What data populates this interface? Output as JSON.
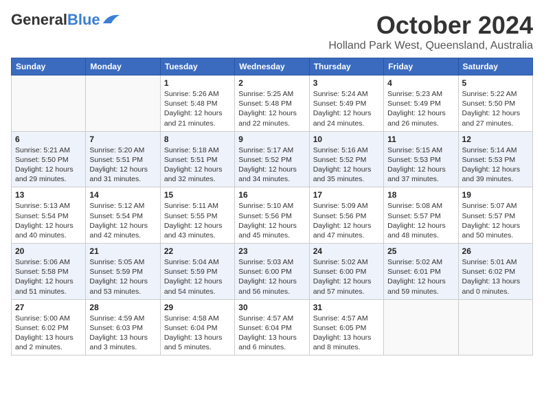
{
  "header": {
    "logo_general": "General",
    "logo_blue": "Blue",
    "month": "October 2024",
    "location": "Holland Park West, Queensland, Australia"
  },
  "days_of_week": [
    "Sunday",
    "Monday",
    "Tuesday",
    "Wednesday",
    "Thursday",
    "Friday",
    "Saturday"
  ],
  "weeks": [
    [
      {
        "day": "",
        "sunrise": "",
        "sunset": "",
        "daylight": ""
      },
      {
        "day": "",
        "sunrise": "",
        "sunset": "",
        "daylight": ""
      },
      {
        "day": "1",
        "sunrise": "Sunrise: 5:26 AM",
        "sunset": "Sunset: 5:48 PM",
        "daylight": "Daylight: 12 hours and 21 minutes."
      },
      {
        "day": "2",
        "sunrise": "Sunrise: 5:25 AM",
        "sunset": "Sunset: 5:48 PM",
        "daylight": "Daylight: 12 hours and 22 minutes."
      },
      {
        "day": "3",
        "sunrise": "Sunrise: 5:24 AM",
        "sunset": "Sunset: 5:49 PM",
        "daylight": "Daylight: 12 hours and 24 minutes."
      },
      {
        "day": "4",
        "sunrise": "Sunrise: 5:23 AM",
        "sunset": "Sunset: 5:49 PM",
        "daylight": "Daylight: 12 hours and 26 minutes."
      },
      {
        "day": "5",
        "sunrise": "Sunrise: 5:22 AM",
        "sunset": "Sunset: 5:50 PM",
        "daylight": "Daylight: 12 hours and 27 minutes."
      }
    ],
    [
      {
        "day": "6",
        "sunrise": "Sunrise: 5:21 AM",
        "sunset": "Sunset: 5:50 PM",
        "daylight": "Daylight: 12 hours and 29 minutes."
      },
      {
        "day": "7",
        "sunrise": "Sunrise: 5:20 AM",
        "sunset": "Sunset: 5:51 PM",
        "daylight": "Daylight: 12 hours and 31 minutes."
      },
      {
        "day": "8",
        "sunrise": "Sunrise: 5:18 AM",
        "sunset": "Sunset: 5:51 PM",
        "daylight": "Daylight: 12 hours and 32 minutes."
      },
      {
        "day": "9",
        "sunrise": "Sunrise: 5:17 AM",
        "sunset": "Sunset: 5:52 PM",
        "daylight": "Daylight: 12 hours and 34 minutes."
      },
      {
        "day": "10",
        "sunrise": "Sunrise: 5:16 AM",
        "sunset": "Sunset: 5:52 PM",
        "daylight": "Daylight: 12 hours and 35 minutes."
      },
      {
        "day": "11",
        "sunrise": "Sunrise: 5:15 AM",
        "sunset": "Sunset: 5:53 PM",
        "daylight": "Daylight: 12 hours and 37 minutes."
      },
      {
        "day": "12",
        "sunrise": "Sunrise: 5:14 AM",
        "sunset": "Sunset: 5:53 PM",
        "daylight": "Daylight: 12 hours and 39 minutes."
      }
    ],
    [
      {
        "day": "13",
        "sunrise": "Sunrise: 5:13 AM",
        "sunset": "Sunset: 5:54 PM",
        "daylight": "Daylight: 12 hours and 40 minutes."
      },
      {
        "day": "14",
        "sunrise": "Sunrise: 5:12 AM",
        "sunset": "Sunset: 5:54 PM",
        "daylight": "Daylight: 12 hours and 42 minutes."
      },
      {
        "day": "15",
        "sunrise": "Sunrise: 5:11 AM",
        "sunset": "Sunset: 5:55 PM",
        "daylight": "Daylight: 12 hours and 43 minutes."
      },
      {
        "day": "16",
        "sunrise": "Sunrise: 5:10 AM",
        "sunset": "Sunset: 5:56 PM",
        "daylight": "Daylight: 12 hours and 45 minutes."
      },
      {
        "day": "17",
        "sunrise": "Sunrise: 5:09 AM",
        "sunset": "Sunset: 5:56 PM",
        "daylight": "Daylight: 12 hours and 47 minutes."
      },
      {
        "day": "18",
        "sunrise": "Sunrise: 5:08 AM",
        "sunset": "Sunset: 5:57 PM",
        "daylight": "Daylight: 12 hours and 48 minutes."
      },
      {
        "day": "19",
        "sunrise": "Sunrise: 5:07 AM",
        "sunset": "Sunset: 5:57 PM",
        "daylight": "Daylight: 12 hours and 50 minutes."
      }
    ],
    [
      {
        "day": "20",
        "sunrise": "Sunrise: 5:06 AM",
        "sunset": "Sunset: 5:58 PM",
        "daylight": "Daylight: 12 hours and 51 minutes."
      },
      {
        "day": "21",
        "sunrise": "Sunrise: 5:05 AM",
        "sunset": "Sunset: 5:59 PM",
        "daylight": "Daylight: 12 hours and 53 minutes."
      },
      {
        "day": "22",
        "sunrise": "Sunrise: 5:04 AM",
        "sunset": "Sunset: 5:59 PM",
        "daylight": "Daylight: 12 hours and 54 minutes."
      },
      {
        "day": "23",
        "sunrise": "Sunrise: 5:03 AM",
        "sunset": "Sunset: 6:00 PM",
        "daylight": "Daylight: 12 hours and 56 minutes."
      },
      {
        "day": "24",
        "sunrise": "Sunrise: 5:02 AM",
        "sunset": "Sunset: 6:00 PM",
        "daylight": "Daylight: 12 hours and 57 minutes."
      },
      {
        "day": "25",
        "sunrise": "Sunrise: 5:02 AM",
        "sunset": "Sunset: 6:01 PM",
        "daylight": "Daylight: 12 hours and 59 minutes."
      },
      {
        "day": "26",
        "sunrise": "Sunrise: 5:01 AM",
        "sunset": "Sunset: 6:02 PM",
        "daylight": "Daylight: 13 hours and 0 minutes."
      }
    ],
    [
      {
        "day": "27",
        "sunrise": "Sunrise: 5:00 AM",
        "sunset": "Sunset: 6:02 PM",
        "daylight": "Daylight: 13 hours and 2 minutes."
      },
      {
        "day": "28",
        "sunrise": "Sunrise: 4:59 AM",
        "sunset": "Sunset: 6:03 PM",
        "daylight": "Daylight: 13 hours and 3 minutes."
      },
      {
        "day": "29",
        "sunrise": "Sunrise: 4:58 AM",
        "sunset": "Sunset: 6:04 PM",
        "daylight": "Daylight: 13 hours and 5 minutes."
      },
      {
        "day": "30",
        "sunrise": "Sunrise: 4:57 AM",
        "sunset": "Sunset: 6:04 PM",
        "daylight": "Daylight: 13 hours and 6 minutes."
      },
      {
        "day": "31",
        "sunrise": "Sunrise: 4:57 AM",
        "sunset": "Sunset: 6:05 PM",
        "daylight": "Daylight: 13 hours and 8 minutes."
      },
      {
        "day": "",
        "sunrise": "",
        "sunset": "",
        "daylight": ""
      },
      {
        "day": "",
        "sunrise": "",
        "sunset": "",
        "daylight": ""
      }
    ]
  ]
}
